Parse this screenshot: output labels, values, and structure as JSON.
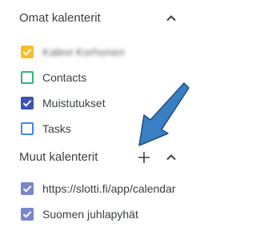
{
  "my_calendars": {
    "title": "Omat kalenterit",
    "collapse_icon": "chevron-up-icon",
    "items": [
      {
        "label": "Kalevi Korhonen",
        "checked": true,
        "color": "#f6bf26",
        "blurred": true
      },
      {
        "label": "Contacts",
        "checked": false,
        "color": "#33b679"
      },
      {
        "label": "Muistutukset",
        "checked": true,
        "color": "#3f51b5"
      },
      {
        "label": "Tasks",
        "checked": false,
        "color": "#4285f4"
      }
    ]
  },
  "other_calendars": {
    "title": "Muut kalenterit",
    "add_icon": "plus-icon",
    "collapse_icon": "chevron-up-icon",
    "items": [
      {
        "label": "https://slotti.fi/app/calendar",
        "checked": true,
        "color": "#7986cb"
      },
      {
        "label": "Suomen juhlapyhät",
        "checked": true,
        "color": "#7986cb"
      }
    ]
  },
  "annotation": {
    "icon": "arrow-pointer-icon",
    "color": "#3a7fc4"
  }
}
